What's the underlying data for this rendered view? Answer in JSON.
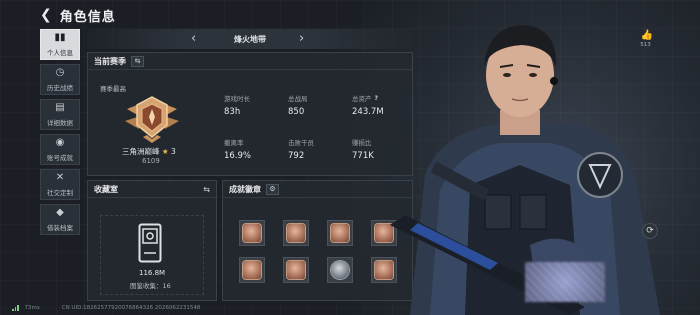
{
  "header": {
    "back_icon": "arrow-left-icon",
    "title": "角色信息"
  },
  "nav": {
    "items": [
      {
        "label": "个人信息",
        "icon": "bar-chart-icon",
        "active": true
      },
      {
        "label": "历史战绩",
        "icon": "history-icon",
        "active": false
      },
      {
        "label": "详细数据",
        "icon": "document-icon",
        "active": false
      },
      {
        "label": "账号成就",
        "icon": "medal-icon",
        "active": false
      },
      {
        "label": "社交定制",
        "icon": "tools-icon",
        "active": false
      },
      {
        "label": "借装档案",
        "icon": "shield-icon",
        "active": false
      }
    ]
  },
  "season_bar": {
    "title": "烽火地带"
  },
  "season_panel": {
    "title": "当前赛季",
    "best_label": "赛季最高",
    "rank_name": "三角洲巅峰",
    "rank_stars": "3",
    "rank_score": "6109",
    "stats": [
      {
        "label": "游戏时长",
        "value": "83h"
      },
      {
        "label": "总战局",
        "value": "850"
      },
      {
        "label": "总资产",
        "value": "243.7M",
        "help": "?"
      },
      {
        "label": "撤离率",
        "value": "16.9%"
      },
      {
        "label": "击败干员",
        "value": "792"
      },
      {
        "label": "赚损比",
        "value": "771K"
      }
    ]
  },
  "collection_panel": {
    "title": "收藏室",
    "value": "116.8M",
    "count_text": "图鉴收集：16"
  },
  "achievement_panel": {
    "title": "成就徽章",
    "badges": [
      "badge",
      "badge",
      "badge",
      "badge",
      "badge",
      "badge",
      "badge-dark",
      "badge"
    ]
  },
  "like": {
    "count": "513"
  },
  "footer": {
    "ping": "73ms",
    "uid_text": "CN UID:18262577920076864326 2026062231548"
  },
  "colors": {
    "accent": "#d8dbde",
    "panel": "#242930",
    "background": "#1b1f25"
  }
}
